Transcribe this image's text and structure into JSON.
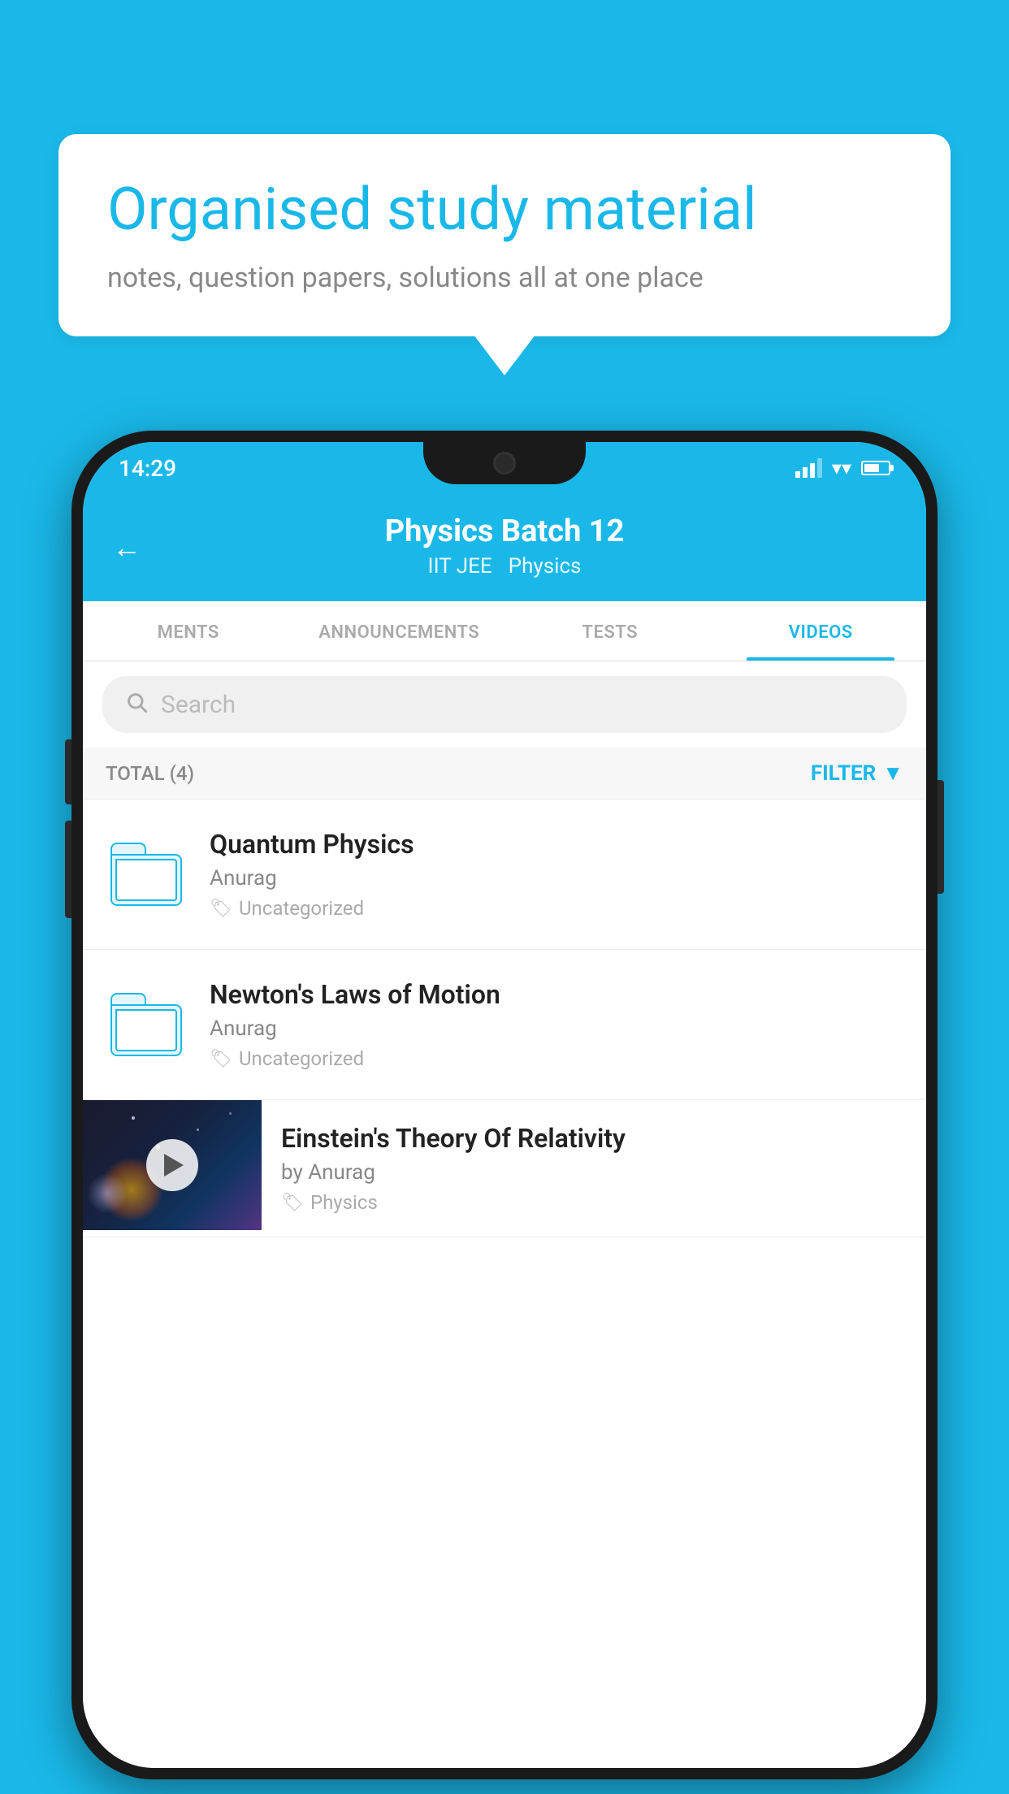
{
  "background_color": "#1ab8e8",
  "speech_bubble": {
    "title": "Organised study material",
    "subtitle": "notes, question papers, solutions all at one place"
  },
  "status_bar": {
    "time": "14:29",
    "wifi": "▼",
    "battery_percent": 65
  },
  "app_header": {
    "back_icon": "←",
    "title": "Physics Batch 12",
    "subtitle_left": "IIT JEE",
    "subtitle_right": "Physics"
  },
  "tabs": [
    {
      "label": "MENTS",
      "active": false
    },
    {
      "label": "ANNOUNCEMENTS",
      "active": false
    },
    {
      "label": "TESTS",
      "active": false
    },
    {
      "label": "VIDEOS",
      "active": true
    }
  ],
  "search": {
    "placeholder": "Search"
  },
  "filter_row": {
    "total_label": "TOTAL (4)",
    "filter_label": "FILTER"
  },
  "list_items": [
    {
      "type": "folder",
      "title": "Quantum Physics",
      "author": "Anurag",
      "tag": "Uncategorized"
    },
    {
      "type": "folder",
      "title": "Newton's Laws of Motion",
      "author": "Anurag",
      "tag": "Uncategorized"
    },
    {
      "type": "video",
      "title": "Einstein's Theory Of Relativity",
      "author": "by Anurag",
      "tag": "Physics"
    }
  ]
}
